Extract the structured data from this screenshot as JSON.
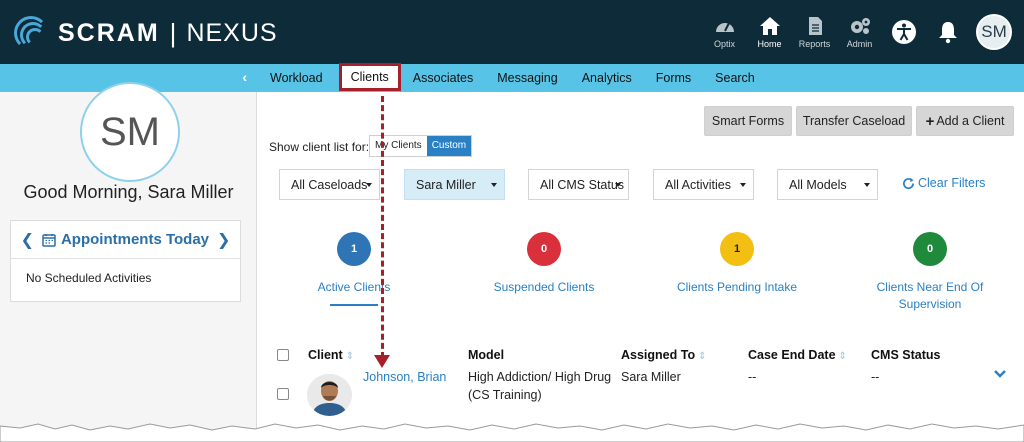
{
  "brand": {
    "name": "SCRAM",
    "separator": "|",
    "product": "NEXUS"
  },
  "topnav": [
    {
      "label": "Optix",
      "icon": "dashboard-icon"
    },
    {
      "label": "Home",
      "icon": "home-icon",
      "active": true
    },
    {
      "label": "Reports",
      "icon": "document-icon"
    },
    {
      "label": "Admin",
      "icon": "gears-icon"
    }
  ],
  "user": {
    "initials": "SM",
    "greeting": "Good Morning, Sara Miller"
  },
  "appointments": {
    "title": "Appointments Today",
    "empty_text": "No Scheduled Activities"
  },
  "subnav": [
    "Workload",
    "Clients",
    "Associates",
    "Messaging",
    "Analytics",
    "Forms",
    "Search"
  ],
  "subnav_active": "Clients",
  "actions": {
    "smart_forms": "Smart Forms",
    "transfer": "Transfer Caseload",
    "add_client": "Add a Client"
  },
  "show_list": {
    "label": "Show client list for:",
    "options": [
      "My Clients",
      "Custom"
    ],
    "selected": "Custom"
  },
  "filters": {
    "caseloads": "All Caseloads",
    "user": "Sara Miller",
    "cms_status": "All CMS Status",
    "activities": "All Activities",
    "models": "All Models",
    "clear": "Clear Filters"
  },
  "stats": [
    {
      "count": "1",
      "label": "Active Clients",
      "color": "#2f74b5",
      "active": true
    },
    {
      "count": "0",
      "label": "Suspended Clients",
      "color": "#d9303b"
    },
    {
      "count": "1",
      "label": "Clients Pending Intake",
      "color": "#f4bf13"
    },
    {
      "count": "0",
      "label": "Clients Near End Of Supervision",
      "color": "#1f8a3b"
    }
  ],
  "table": {
    "columns": [
      "Client",
      "Model",
      "Assigned To",
      "Case End Date",
      "CMS Status"
    ],
    "rows": [
      {
        "client": "Johnson, Brian",
        "model_line1": "High Addiction/ High Drug",
        "model_line2": "(CS Training)",
        "assigned_to": "Sara Miller",
        "case_end_date": "--",
        "cms_status": "--"
      }
    ]
  },
  "colors": {
    "header_bg": "#0d2b38",
    "nav_bg": "#57c3e6",
    "link": "#2a80c5",
    "annotation": "#a6202c"
  }
}
